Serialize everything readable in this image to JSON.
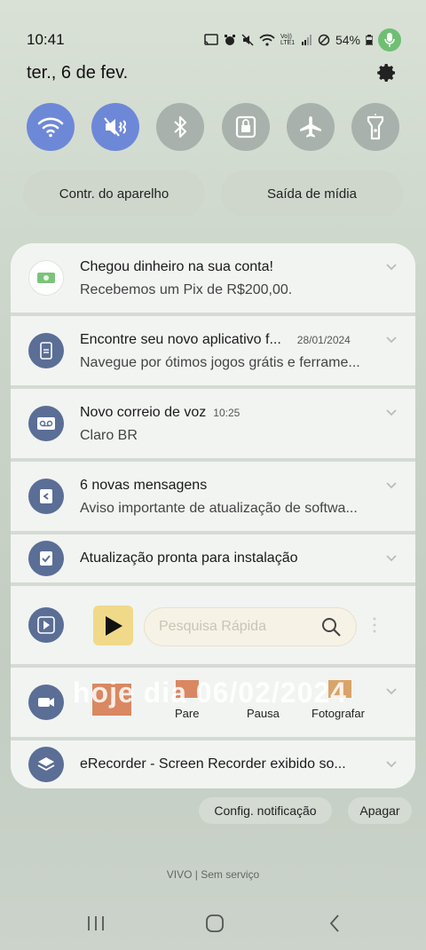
{
  "status_bar": {
    "time": "10:41",
    "network_label": "Vo)) LTE1",
    "battery": "54%"
  },
  "header": {
    "date": "ter., 6 de fev."
  },
  "quick_settings": [
    {
      "name": "wifi-icon",
      "on": true
    },
    {
      "name": "sound-muted-icon",
      "on": true
    },
    {
      "name": "bluetooth-icon",
      "on": false
    },
    {
      "name": "lock-rotation-icon",
      "on": false
    },
    {
      "name": "airplane-icon",
      "on": false
    },
    {
      "name": "flashlight-icon",
      "on": false
    }
  ],
  "pills": {
    "device_control": "Contr. do aparelho",
    "media_output": "Saída de mídia"
  },
  "notifications": [
    {
      "title": "Chegou dinheiro na sua conta!",
      "time": "",
      "body": "Recebemos um Pix de R$200,00."
    },
    {
      "title": "Encontre seu novo aplicativo f...",
      "time": "28/01/2024",
      "body": "Navegue por ótimos jogos grátis e ferrame..."
    },
    {
      "title": "Novo correio de voz",
      "time": "10:25",
      "body": "Claro BR"
    },
    {
      "title": "6 novas mensagens",
      "time": "",
      "body": "Aviso importante de atualização de softwa..."
    },
    {
      "title": "Atualização pronta para instalação",
      "time": "",
      "body": ""
    }
  ],
  "quick_search": {
    "placeholder": "Pesquisa Rápida"
  },
  "recorder": {
    "stop": "Pare",
    "pause": "Pausa",
    "photo": "Fotografar",
    "overlay": "hoje dia 06/02/2024"
  },
  "erecorder": {
    "title": "eRecorder - Screen Recorder exibido so..."
  },
  "actions": {
    "settings": "Config. notificação",
    "clear": "Apagar"
  },
  "carrier": "VIVO | Sem serviço",
  "colors": {
    "accent_on": "#6e88d8",
    "tile_off": "#a8b1ab",
    "icon_circle": "#5a6e96"
  }
}
